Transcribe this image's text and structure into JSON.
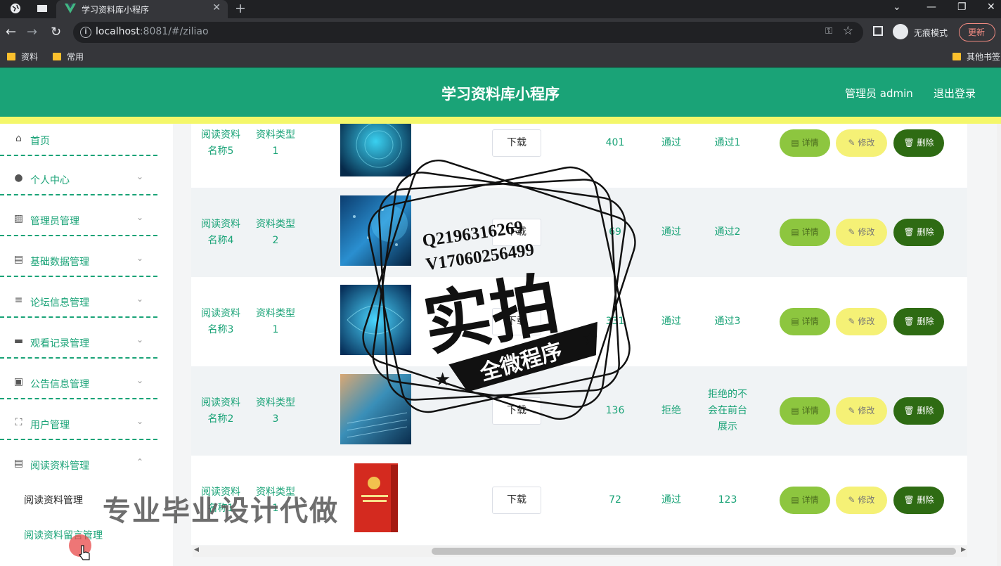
{
  "browser": {
    "tab_title": "学习资料库小程序",
    "url_host": "localhost",
    "url_rest": ":8081/#/ziliao",
    "incognito_label": "无痕模式",
    "update_label": "更新",
    "bookmarks": [
      "资料",
      "常用"
    ],
    "other_bookmarks": "其他书签"
  },
  "header": {
    "title": "学习资料库小程序",
    "user": "管理员 admin",
    "logout": "退出登录"
  },
  "sidebar": {
    "items": [
      {
        "label": "首页",
        "icon": "home-icon"
      },
      {
        "label": "个人中心",
        "icon": "user-icon"
      },
      {
        "label": "管理员管理",
        "icon": "chart-icon"
      },
      {
        "label": "基础数据管理",
        "icon": "message-icon"
      },
      {
        "label": "论坛信息管理",
        "icon": "sliders-icon"
      },
      {
        "label": "观看记录管理",
        "icon": "briefcase-icon"
      },
      {
        "label": "公告信息管理",
        "icon": "clipboard-icon"
      },
      {
        "label": "用户管理",
        "icon": "fullscreen-icon"
      },
      {
        "label": "阅读资料管理",
        "icon": "document-icon"
      }
    ],
    "sub_items": [
      "阅读资料管理",
      "阅读资料留言管理"
    ]
  },
  "table": {
    "rows": [
      {
        "name_a": "阅读资料",
        "name_b": "名称5",
        "type_a": "资料类型",
        "type_b": "1",
        "download": "下载",
        "count": "401",
        "status": "通过",
        "reply": [
          "通过1"
        ]
      },
      {
        "name_a": "阅读资料",
        "name_b": "名称4",
        "type_a": "资料类型",
        "type_b": "2",
        "download": "下载",
        "count": "69",
        "status": "通过",
        "reply": [
          "通过2"
        ]
      },
      {
        "name_a": "阅读资料",
        "name_b": "名称3",
        "type_a": "资料类型",
        "type_b": "1",
        "download": "下载",
        "count": "331",
        "status": "通过",
        "reply": [
          "通过3"
        ]
      },
      {
        "name_a": "阅读资料",
        "name_b": "名称2",
        "type_a": "资料类型",
        "type_b": "3",
        "download": "下载",
        "count": "136",
        "status": "拒绝",
        "reply": [
          "拒绝的不",
          "会在前台",
          "展示"
        ]
      },
      {
        "name_a": "阅读资料",
        "name_b": "名称1",
        "type_a": "资料类型",
        "type_b": "1",
        "download": "下载",
        "count": "72",
        "status": "通过",
        "reply": [
          "123"
        ]
      }
    ],
    "actions": {
      "detail": "详情",
      "edit": "修改",
      "delete": "删除"
    }
  },
  "watermark": {
    "qq": "Q2196316269",
    "v": "V17060256499",
    "big": "实拍",
    "ribbon": "全微程序",
    "bottom": "专业毕业设计代做"
  },
  "colors": {
    "accent": "#1aa377",
    "yellow": "#f4f76a",
    "detail": "#8dc63f",
    "edit": "#f5f176",
    "delete": "#2e6b13"
  }
}
